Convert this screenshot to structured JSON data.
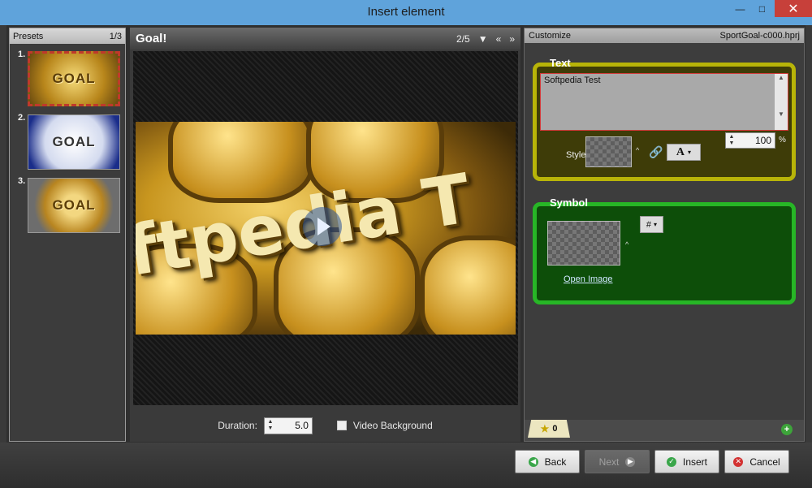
{
  "window": {
    "title": "Insert element",
    "minimize_glyph": "—",
    "maximize_glyph": "□",
    "close_glyph": "✕"
  },
  "presets": {
    "header": "Presets",
    "page": "1/3",
    "items": [
      {
        "number": "1.",
        "label": "GOAL",
        "selected": true
      },
      {
        "number": "2.",
        "label": "GOAL",
        "selected": false
      },
      {
        "number": "3.",
        "label": "GOAL",
        "selected": false
      }
    ]
  },
  "preview": {
    "title": "Goal!",
    "position": "2/5",
    "video_text": "ftpedia T",
    "duration_label": "Duration:",
    "duration_value": "5.0",
    "video_background_label": "Video Background",
    "video_background_checked": false
  },
  "customize": {
    "header": "Customize",
    "project_file": "SportGoal-c000.hprj",
    "text_group": {
      "title": "Text",
      "text_value": "Softpedia Test",
      "size_value": "100",
      "size_unit": "%",
      "style_label": "Style:",
      "font_button_label": "A"
    },
    "symbol_group": {
      "title": "Symbol",
      "symbol_button_label": "#",
      "open_image_label": "Open Image"
    },
    "tabs": [
      {
        "label": "0",
        "icon": "star-icon"
      }
    ]
  },
  "buttons": {
    "back": "Back",
    "next": "Next",
    "insert": "Insert",
    "cancel": "Cancel"
  },
  "colors": {
    "title_bar": "#5fa3db",
    "text_group_border": "#b8b408",
    "symbol_group_border": "#27b626",
    "close_button": "#c7403a"
  }
}
